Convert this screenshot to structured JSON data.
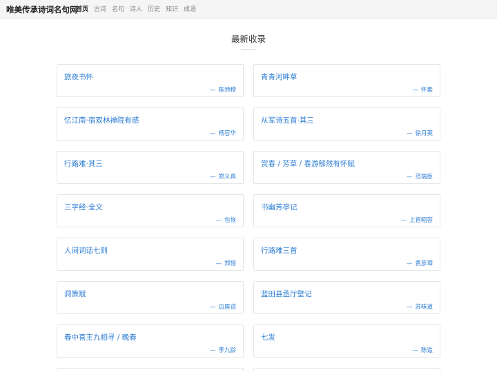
{
  "site": {
    "brand": "唯美传承诗词名句网"
  },
  "nav": [
    {
      "label": "首页",
      "active": true
    },
    {
      "label": "古诗",
      "active": false
    },
    {
      "label": "名句",
      "active": false
    },
    {
      "label": "诗人",
      "active": false
    },
    {
      "label": "历史",
      "active": false
    },
    {
      "label": "知识",
      "active": false
    },
    {
      "label": "成语",
      "active": false
    }
  ],
  "section": {
    "title": "最新收录"
  },
  "author_prefix": "—",
  "cards": [
    {
      "title": "旅夜书怀",
      "author": "陈师穆"
    },
    {
      "title": "青青河畔草",
      "author": "怀素"
    },
    {
      "title": "忆江南·宿双林禅院有感",
      "author": "杨容华"
    },
    {
      "title": "从军诗五首·其三",
      "author": "徐月英"
    },
    {
      "title": "行路难·其三",
      "author": "郑义真"
    },
    {
      "title": "赏春 / 芳草 / 春游郁然有怀赋",
      "author": "范端臣"
    },
    {
      "title": "三字经·全文",
      "author": "包恢"
    },
    {
      "title": "书幽芳亭记",
      "author": "上官昭容"
    },
    {
      "title": "人间词话七则",
      "author": "郑愔"
    },
    {
      "title": "行路难三首",
      "author": "贾彦璋"
    },
    {
      "title": "洞箫赋",
      "author": "边居谊"
    },
    {
      "title": "蓝田县丞厅壁记",
      "author": "苏味道"
    },
    {
      "title": "春中喜王九相寻 / 晚春",
      "author": "李九龄"
    },
    {
      "title": "七发",
      "author": "陈造"
    }
  ]
}
